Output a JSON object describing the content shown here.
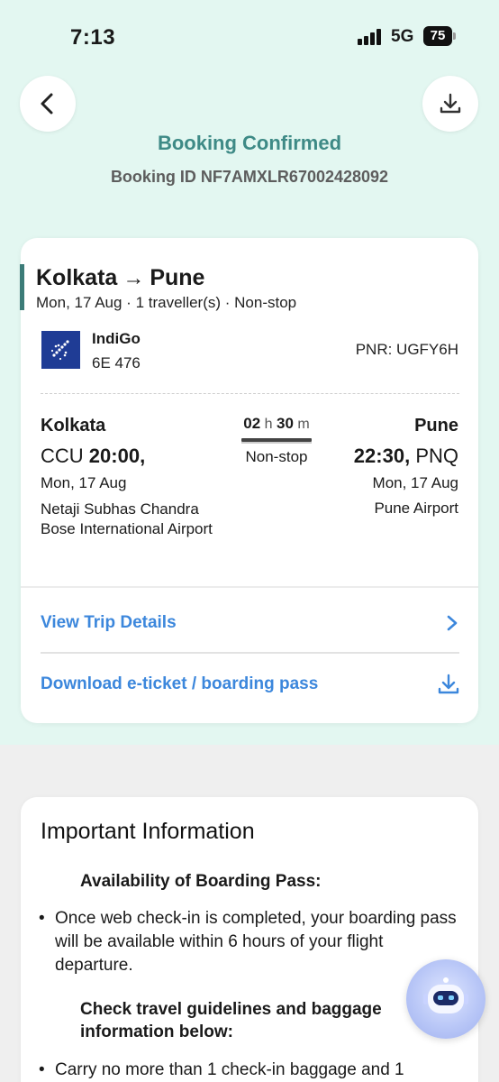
{
  "status_bar": {
    "time": "7:13",
    "network": "5G",
    "battery": "75"
  },
  "header": {
    "title": "Booking Confirmed",
    "booking_id": "Booking ID NF7AMXLR67002428092"
  },
  "trip": {
    "origin": "Kolkata",
    "arrow": "→",
    "destination": "Pune",
    "meta": "Mon, 17 Aug · 1 traveller(s) · Non-stop",
    "airline": "IndiGo",
    "flight_number": "6E 476",
    "pnr": "PNR:  UGFY6H",
    "departure": {
      "city": "Kolkata",
      "code": "CCU",
      "time": "20:00,",
      "date": "Mon, 17 Aug",
      "airport": "Netaji Subhas Chandra Bose International Airport"
    },
    "duration": {
      "hours": "02",
      "hours_unit": "h",
      "minutes": "30",
      "minutes_unit": "m",
      "stops": "Non-stop"
    },
    "arrival": {
      "city": "Pune",
      "time": "22:30,",
      "code": "PNQ",
      "date": "Mon, 17 Aug",
      "airport": "Pune Airport"
    },
    "view_trip_label": "View Trip Details",
    "download_label": "Download e-ticket / boarding pass"
  },
  "info": {
    "title": "Important Information",
    "sections": [
      {
        "heading": "Availability of Boarding Pass:",
        "bullet": "Once web check-in is completed, your boarding pass will be available within 6 hours of your flight departure."
      },
      {
        "heading": "Check travel guidelines and baggage information below:",
        "bullet": "Carry no more than 1 check-in baggage and 1"
      }
    ]
  },
  "colors": {
    "header_bg": "#e3f7f1",
    "title": "#3e8a86",
    "link": "#3c87dc",
    "airline_logo": "#1f3c95"
  },
  "icons": [
    "back-arrow-icon",
    "download-icon",
    "chevron-right-icon",
    "indigo-plane-logo",
    "chatbot-robot-icon"
  ]
}
